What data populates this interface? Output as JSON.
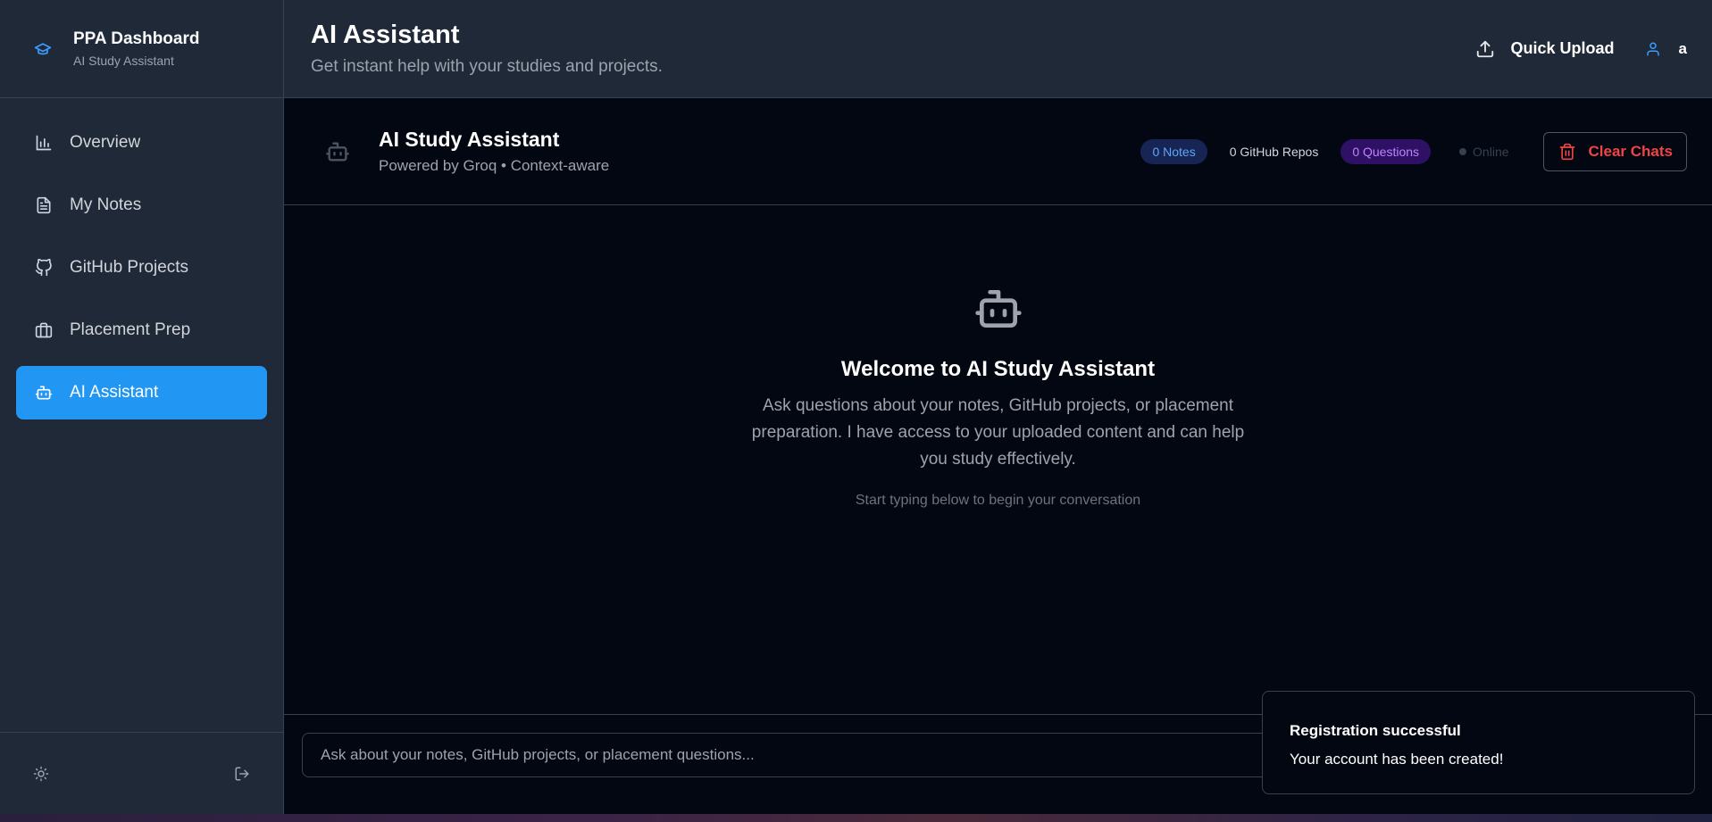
{
  "sidebar": {
    "brand_title": "PPA Dashboard",
    "brand_subtitle": "AI Study Assistant",
    "brand_icon": "graduation-cap-icon",
    "items": [
      {
        "label": "Overview",
        "icon": "bar-chart-icon"
      },
      {
        "label": "My Notes",
        "icon": "file-text-icon"
      },
      {
        "label": "GitHub Projects",
        "icon": "github-icon"
      },
      {
        "label": "Placement Prep",
        "icon": "briefcase-icon"
      },
      {
        "label": "AI Assistant",
        "icon": "bot-icon",
        "active": true
      }
    ],
    "footer": {
      "theme_icon": "sun-icon",
      "logout_icon": "logout-icon"
    }
  },
  "header": {
    "title": "AI Assistant",
    "subtitle": "Get instant help with your studies and projects.",
    "quick_upload_label": "Quick Upload",
    "user_name": "a"
  },
  "chat": {
    "title": "AI Study Assistant",
    "subtitle": "Powered by Groq • Context-aware",
    "badges": {
      "notes": "0 Notes",
      "repos": "0 GitHub Repos",
      "questions": "0 Questions"
    },
    "status": "Online",
    "clear_label": "Clear Chats",
    "welcome_title": "Welcome to AI Study Assistant",
    "welcome_text": "Ask questions about your notes, GitHub projects, or placement preparation. I have access to your uploaded content and can help you study effectively.",
    "welcome_hint": "Start typing below to begin your conversation",
    "input_placeholder": "Ask about your notes, GitHub projects, or placement questions..."
  },
  "toast": {
    "title": "Registration successful",
    "description": "Your account has been created!"
  },
  "colors": {
    "accent": "#2196f3",
    "danger": "#ef4444",
    "notes_badge": "#60a5fa",
    "questions_badge": "#c084fc"
  }
}
